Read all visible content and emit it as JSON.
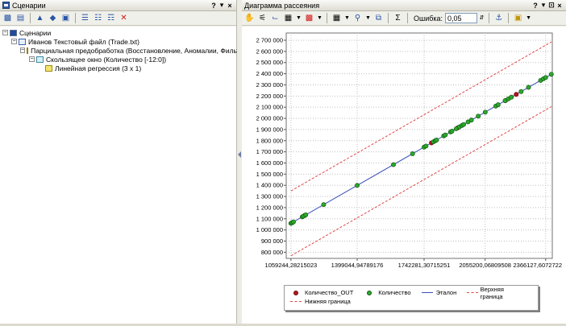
{
  "left_panel": {
    "title": "Сценарии",
    "controls": [
      "?",
      "▾",
      "×"
    ],
    "toolbar": [
      "wizard-icon",
      "open-icon",
      "import-icon",
      "process-icon",
      "export-icon",
      "tree-a-icon",
      "tree-b-icon",
      "tree-c-icon",
      "delete-icon"
    ],
    "tree": [
      {
        "label": "Сценарии",
        "level": 0,
        "expander": "−",
        "icon": "root"
      },
      {
        "label": "Иванов Текстовый файл (Trade.txt)",
        "level": 1,
        "expander": "−",
        "icon": "file"
      },
      {
        "label": "Парциальная предобработка (Восстановление, Аномалии, Фильтрация)",
        "level": 2,
        "expander": "−",
        "icon": "proc"
      },
      {
        "label": "Скользящее окно (Количество [-12:0])",
        "level": 3,
        "expander": "−",
        "icon": "window"
      },
      {
        "label": "Линейная регрессия (3 x 1)",
        "level": 4,
        "expander": "",
        "icon": "reg"
      }
    ]
  },
  "right_panel": {
    "title": "Диаграмма рассеяния",
    "controls": [
      "?",
      "▾",
      "⊡",
      "×"
    ],
    "toolbar": {
      "error_label": "Ошибка:",
      "error_value": "0,05",
      "sigma": "Σ"
    }
  },
  "chart_data": {
    "type": "scatter",
    "x_ticks": [
      {
        "value": 1059244.28215023,
        "label": "1059244,28215023"
      },
      {
        "value": 1399044.94789176,
        "label": "1399044,94789176"
      },
      {
        "value": 1742281.30715251,
        "label": "1742281,30715251"
      },
      {
        "value": 2055200.06809508,
        "label": "2055200,06809508"
      },
      {
        "value": 2366127.6072722,
        "label": "2366127,6072722"
      }
    ],
    "y_ticks": [
      "800 000",
      "900 000",
      "1 000 000",
      "1 100 000",
      "1 200 000",
      "1 300 000",
      "1 400 000",
      "1 500 000",
      "1 600 000",
      "1 700 000",
      "1 800 000",
      "1 900 000",
      "2 000 000",
      "2 100 000",
      "2 200 000",
      "2 300 000",
      "2 400 000",
      "2 500 000",
      "2 600 000",
      "2 700 000"
    ],
    "y_tick_values": [
      800000,
      900000,
      1000000,
      1100000,
      1200000,
      1300000,
      1400000,
      1500000,
      1600000,
      1700000,
      1800000,
      1900000,
      2000000,
      2100000,
      2200000,
      2300000,
      2400000,
      2500000,
      2600000,
      2700000
    ],
    "xlim": [
      1035000,
      2400000
    ],
    "ylim": [
      745000,
      2765000
    ],
    "grid": true,
    "legend_position": "bottom",
    "series": [
      {
        "name": "Количество_OUT",
        "kind": "points",
        "color": "#b5141a",
        "x": [
          1068000,
          1130000,
          1780000,
          1915000,
          2160000,
          2215000
        ],
        "y": [
          1068000,
          1130000,
          1780000,
          1915000,
          2160000,
          2215000
        ]
      },
      {
        "name": "Количество",
        "kind": "points",
        "color": "#2ca82c",
        "x": [
          1059000,
          1065000,
          1072000,
          1117000,
          1124000,
          1135000,
          1227000,
          1399000,
          1585000,
          1683000,
          1742000,
          1752000,
          1790000,
          1800000,
          1806000,
          1843000,
          1851000,
          1878000,
          1885000,
          1907000,
          1923000,
          1936000,
          1945000,
          1968000,
          1985000,
          2020000,
          2056000,
          2110000,
          2122000,
          2158000,
          2175000,
          2190000,
          2240000,
          2278000,
          2340000,
          2354000,
          2366000,
          2395000
        ],
        "y": [
          1059000,
          1065000,
          1072000,
          1117000,
          1124000,
          1135000,
          1227000,
          1399000,
          1585000,
          1683000,
          1742000,
          1752000,
          1790000,
          1800000,
          1806000,
          1843000,
          1851000,
          1878000,
          1885000,
          1907000,
          1923000,
          1936000,
          1945000,
          1968000,
          1985000,
          2020000,
          2056000,
          2110000,
          2122000,
          2158000,
          2175000,
          2190000,
          2240000,
          2278000,
          2340000,
          2354000,
          2366000,
          2395000
        ]
      },
      {
        "name": "Эталон",
        "kind": "line",
        "color": "#3a4fb8",
        "dash": false,
        "x": [
          1059244,
          2395000
        ],
        "y": [
          1059244,
          2395000
        ]
      },
      {
        "name": "Верхняя граница",
        "kind": "line",
        "color": "#e04848",
        "dash": true,
        "x": [
          1059244,
          2395000
        ],
        "y": [
          1350000,
          2685000
        ]
      },
      {
        "name": "Нижняя граница",
        "kind": "line",
        "color": "#e04848",
        "dash": true,
        "x": [
          1059244,
          2395000
        ],
        "y": [
          768000,
          2105000
        ]
      }
    ]
  },
  "colors": {
    "panel_bg": "#f0f0ea",
    "grid": "#c0c0c0",
    "accent": "#2a55a6"
  }
}
